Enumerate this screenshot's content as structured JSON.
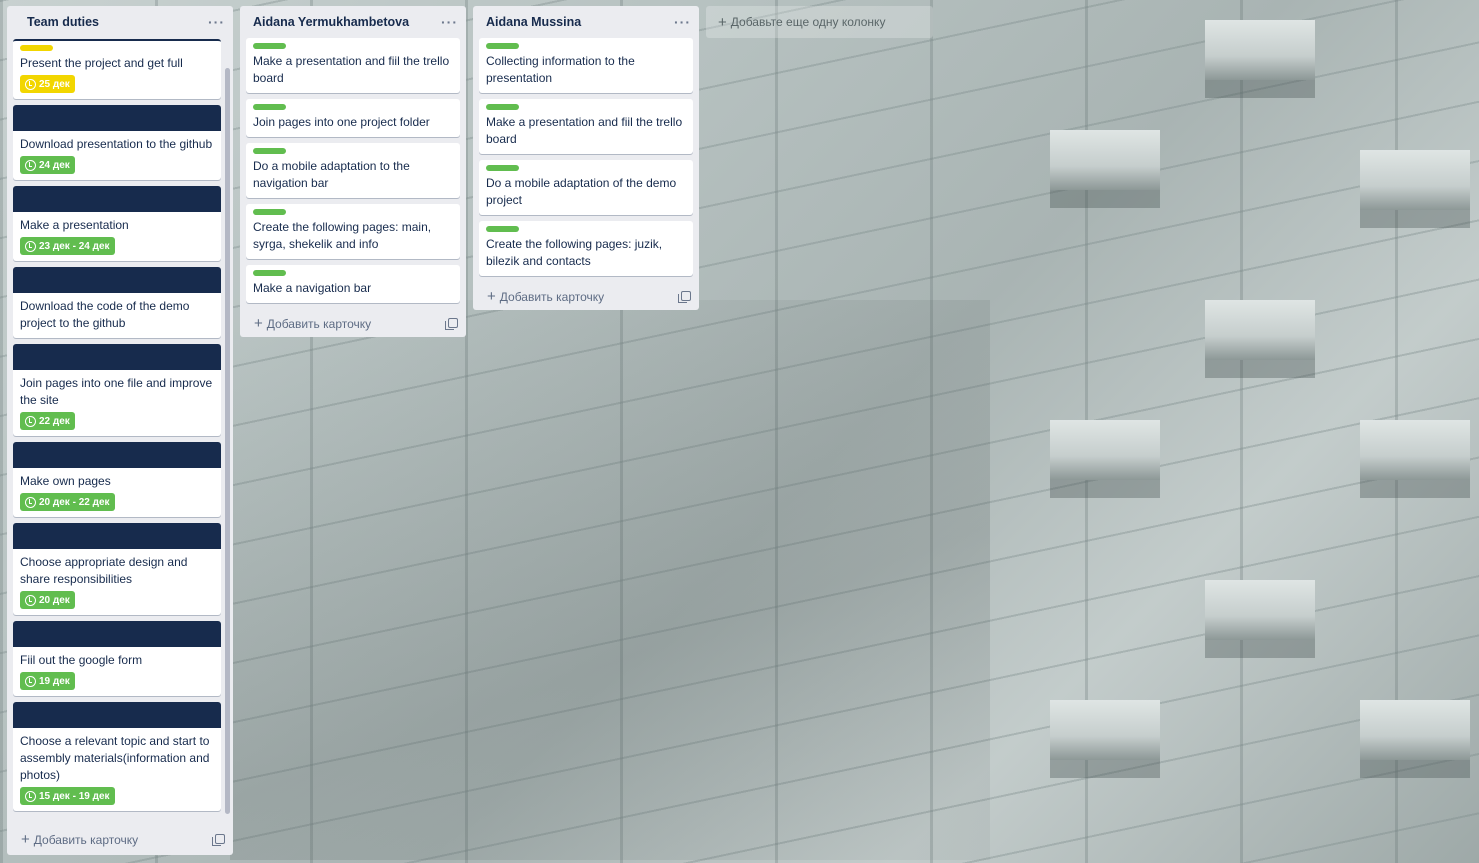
{
  "lists": [
    {
      "title": "Team duties",
      "cards": [
        {
          "title": "Present the project and get full",
          "label": "yellow",
          "cover": false,
          "due": "25 дек",
          "due_color": "yellow"
        },
        {
          "title": "Download presentation to the github",
          "cover": true,
          "due": "24 дек"
        },
        {
          "title": "Make a presentation",
          "cover": true,
          "due": "23 дек - 24 дек"
        },
        {
          "title": "Download the code of the demo project to the github",
          "cover": true
        },
        {
          "title": "Join pages into one file and improve the site",
          "cover": true,
          "due": "22 дек"
        },
        {
          "title": "Make own pages",
          "cover": true,
          "due": "20 дек - 22 дек"
        },
        {
          "title": "Choose appropriate design and share responsibilities",
          "cover": true,
          "due": "20 дек"
        },
        {
          "title": "Fiil out the google form",
          "cover": true,
          "due": "19 дек"
        },
        {
          "title": "Choose a relevant topic and start to assembly materials(information and photos)",
          "cover": true,
          "due": "15 дек - 19 дек"
        }
      ],
      "add_card": "Добавить карточку"
    },
    {
      "title": "Aidana Yermukhambetova",
      "cards": [
        {
          "title": "Make a presentation and fiil the trello board",
          "label": "green"
        },
        {
          "title": "Join pages into one project folder",
          "label": "green"
        },
        {
          "title": "Do a mobile adaptation to the navigation bar",
          "label": "green"
        },
        {
          "title": "Create the following pages: main, syrga, shekelik and info",
          "label": "green"
        },
        {
          "title": "Make a navigation bar",
          "label": "green"
        }
      ],
      "add_card": "Добавить карточку"
    },
    {
      "title": "Aidana Mussina",
      "cards": [
        {
          "title": "Collecting information to the presentation",
          "label": "green"
        },
        {
          "title": "Make a presentation and fiil the trello board",
          "label": "green"
        },
        {
          "title": "Do a mobile adaptation of the demo project",
          "label": "green"
        },
        {
          "title": "Create the following pages: juzik, bilezik and contacts",
          "label": "green"
        }
      ],
      "add_card": "Добавить карточку"
    }
  ],
  "add_column": "Добавьте еще одну колонку",
  "colors": {
    "list_bg": "#ebecf0",
    "cover": "#172b4d",
    "green": "#61bd4f",
    "yellow": "#f2d600"
  },
  "icons": {
    "menu": "more-dots-icon",
    "clock": "clock-icon",
    "template": "card-template-icon",
    "plus": "plus-icon"
  }
}
